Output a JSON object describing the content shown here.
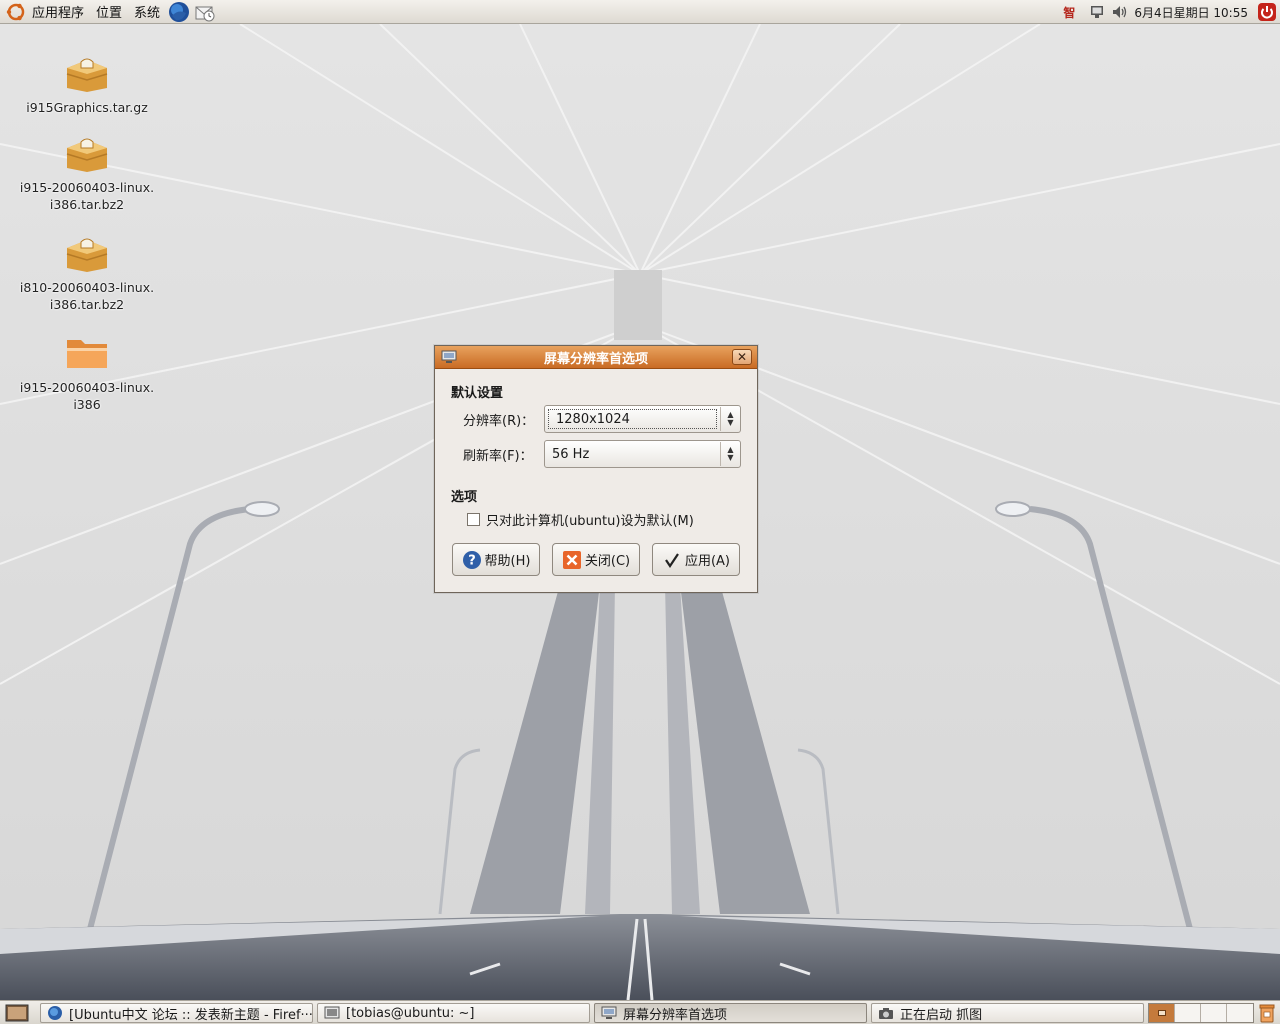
{
  "top_panel": {
    "menus": [
      {
        "label": "应用程序"
      },
      {
        "label": "位置"
      },
      {
        "label": "系统"
      }
    ],
    "launchers": [
      {
        "icon": "firefox-icon"
      },
      {
        "icon": "mail-icon"
      }
    ],
    "tray": {
      "icons": [
        "input-method-icon",
        "network-icon",
        "volume-icon"
      ],
      "input_method_label": "智",
      "clock": "6月4日星期日 10:55",
      "power_icon": "power-icon"
    }
  },
  "desktop_icons": [
    {
      "name": "i915Graphics.tar.gz",
      "icon": "archive-icon"
    },
    {
      "name": "i915-20060403-linux.\ni386.tar.bz2",
      "icon": "archive-icon"
    },
    {
      "name": "i810-20060403-linux.\ni386.tar.bz2",
      "icon": "archive-icon"
    },
    {
      "name": "i915-20060403-linux.\ni386",
      "icon": "folder-icon"
    }
  ],
  "dialog": {
    "title": "屏幕分辨率首选项",
    "default_section": "默认设置",
    "resolution_label": "分辨率(R)：",
    "resolution_value": "1280x1024",
    "refresh_label": "刷新率(F)：",
    "refresh_value": "56 Hz",
    "options_section": "选项",
    "checkbox_label": "只对此计算机(ubuntu)设为默认(M)",
    "checkbox_checked": false,
    "buttons": {
      "help": "帮助(H)",
      "close": "关闭(C)",
      "apply": "应用(A)"
    }
  },
  "bottom_panel": {
    "tasks": [
      {
        "label": "[Ubuntu中文 论坛 :: 发表新主题 - Firef···",
        "icon": "firefox-icon",
        "active": false
      },
      {
        "label": "[tobias@ubuntu: ~]",
        "icon": "terminal-icon",
        "active": false
      },
      {
        "label": "屏幕分辨率首选项",
        "icon": "display-icon",
        "active": true
      },
      {
        "label": "正在启动 抓图",
        "icon": "camera-icon",
        "active": false
      }
    ],
    "workspaces": 4,
    "active_workspace": 1
  },
  "colors": {
    "accent": "#c96b24",
    "panel": "#e6e2dc",
    "wallpaper": "#dcdcdc"
  }
}
